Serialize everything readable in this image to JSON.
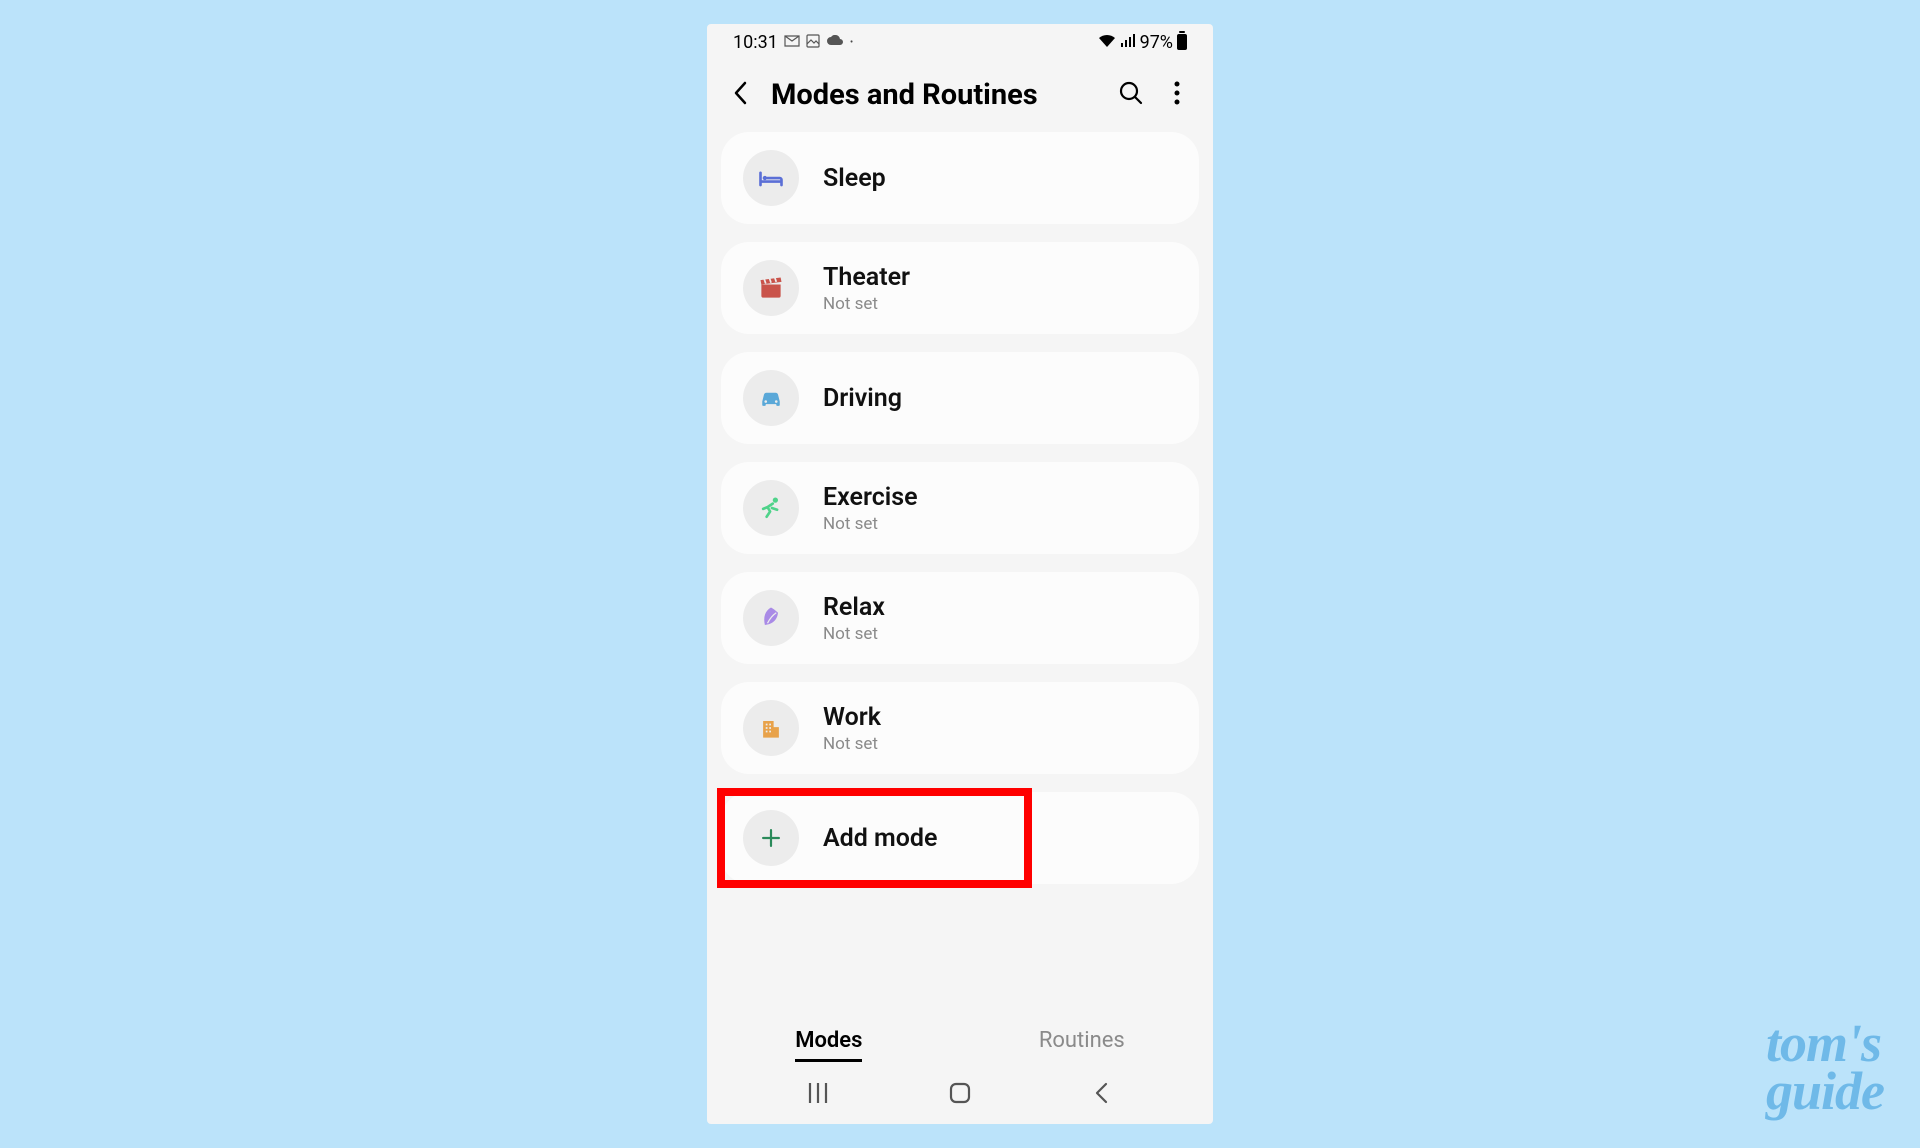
{
  "statusbar": {
    "time": "10:31",
    "battery_pct": "97%"
  },
  "header": {
    "title": "Modes and Routines"
  },
  "modes": [
    {
      "label": "Sleep",
      "sub": "",
      "icon": "bed",
      "color": "#5b6fd6"
    },
    {
      "label": "Theater",
      "sub": "Not set",
      "icon": "clapper",
      "color": "#c9534a"
    },
    {
      "label": "Driving",
      "sub": "",
      "icon": "car",
      "color": "#5aa8d8"
    },
    {
      "label": "Exercise",
      "sub": "Not set",
      "icon": "runner",
      "color": "#4fd38a"
    },
    {
      "label": "Relax",
      "sub": "Not set",
      "icon": "leaf",
      "color": "#a98ae6"
    },
    {
      "label": "Work",
      "sub": "Not set",
      "icon": "building",
      "color": "#e8a24a"
    }
  ],
  "add": {
    "label": "Add mode"
  },
  "tabs": {
    "active": "Modes",
    "other": "Routines"
  },
  "watermark": {
    "line1": "tom's",
    "line2": "guide"
  }
}
